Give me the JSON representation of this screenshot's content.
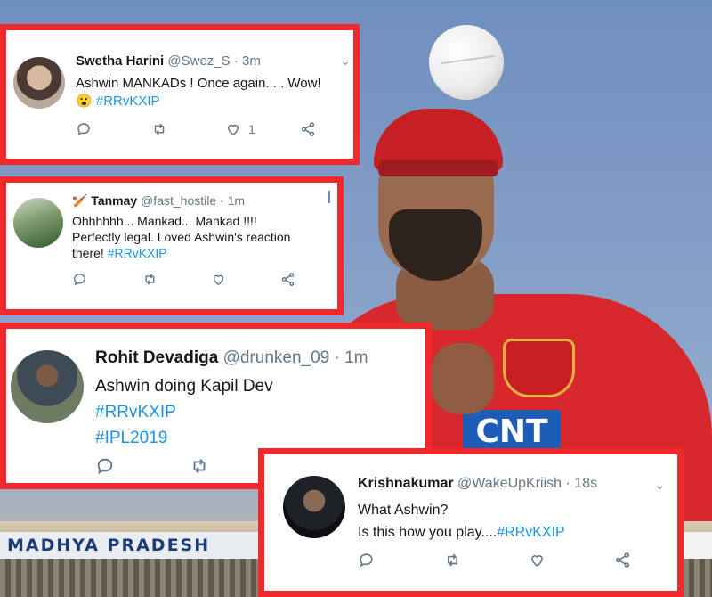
{
  "background": {
    "stand_sign": "MADHYA PRADESH",
    "sponsor_text": "CNT"
  },
  "tweets": [
    {
      "name": "Swetha Harini",
      "handle": "@Swez_S",
      "time": "· 3m",
      "text": "Ashwin MANKADs ! Once again. . . Wow!",
      "emoji": "😮",
      "hashtags": [
        "#RRvKXIP"
      ],
      "like_count": "1",
      "has_chevron": true
    },
    {
      "name_prefix_icon": "cricket-bat-icon",
      "name": "Tanmay",
      "handle": "@fast_hostile",
      "time": "· 1m",
      "text_lines": [
        "Ohhhhhh... Mankad... Mankad !!!!",
        "Perfectly legal. Loved Ashwin's reaction",
        "there! "
      ],
      "hashtags": [
        "#RRvKXIP"
      ]
    },
    {
      "name": "Rohit Devadiga",
      "handle": "@drunken_09",
      "time": "· 1m",
      "text": "Ashwin doing Kapil Dev",
      "hashtags": [
        "#RRvKXIP",
        "#IPL2019"
      ]
    },
    {
      "name": "Krishnakumar",
      "handle": "@WakeUpKriish",
      "time": "· 18s",
      "text_lines": [
        "What Ashwin?",
        "Is this how you play...."
      ],
      "hashtags": [
        "#RRvKXIP"
      ],
      "has_chevron": true
    }
  ],
  "colors": {
    "frame_red": "#f0292e",
    "hashtag_blue": "#1b95e0",
    "meta_grey": "#657786"
  },
  "icons": [
    "reply-icon",
    "retweet-icon",
    "like-icon",
    "share-icon",
    "chevron-down-icon"
  ]
}
